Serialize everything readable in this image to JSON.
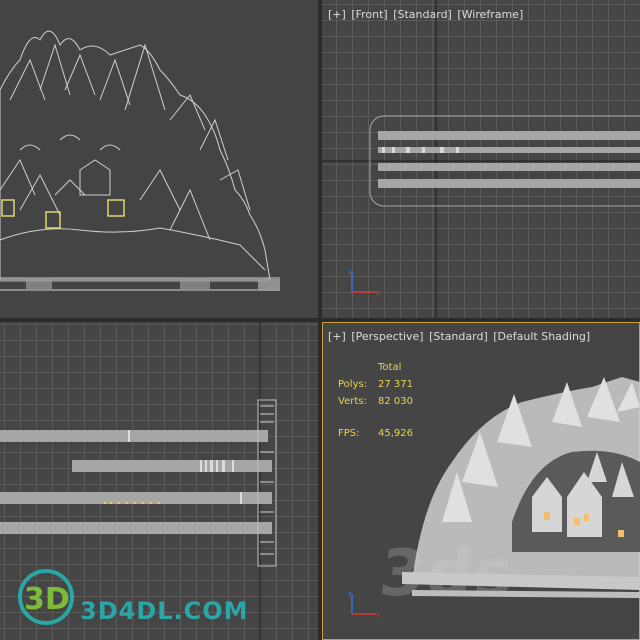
{
  "viewports": {
    "top_left": {},
    "front": {
      "label": [
        "[+]",
        "[Front]",
        "[Standard]",
        "[Wireframe]"
      ]
    },
    "left": {},
    "perspective": {
      "label": [
        "[+]",
        "[Perspective]",
        "[Standard]",
        "[Default Shading]"
      ],
      "stats": {
        "header": "Total",
        "polys_label": "Polys:",
        "polys_value": "27 371",
        "verts_label": "Verts:",
        "verts_value": "82 030",
        "fps_label": "FPS:",
        "fps_value": "45,926"
      },
      "watermark": "3ds"
    }
  },
  "logo": {
    "mark": "3D",
    "text": "3D4DL.COM"
  },
  "colors": {
    "grid": "#5a5a5a",
    "wire": "#cfcfcf",
    "stats": "#e8d44d",
    "active_border": "#c8a040",
    "logo": "#2aa6a6"
  }
}
